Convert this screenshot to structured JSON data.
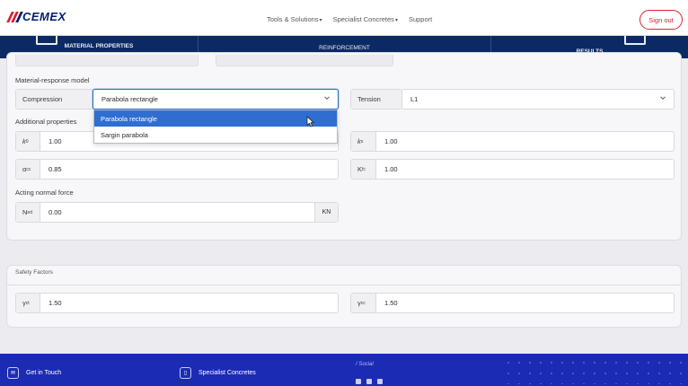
{
  "header": {
    "brand": "CEMEX",
    "nav": [
      "Tools & Solutions",
      "Specialist Concretes",
      "Support"
    ],
    "nav_caret": "▾",
    "signout_label": "Sign out"
  },
  "steps": {
    "items": [
      "MATERIAL PROPERTIES",
      "REINFORCEMENT",
      "RESULTS"
    ]
  },
  "material_model": {
    "section_label": "Material-response model",
    "compression": {
      "label": "Compression",
      "value": "Parabola rectangle"
    },
    "tension": {
      "label": "Tension",
      "value": "L1"
    },
    "dropdown_options": [
      "Parabola rectangle",
      "Sargin parabola"
    ],
    "dropdown_selected_index": 0
  },
  "additional": {
    "section_label": "Additional properties",
    "k0": {
      "label": "k0",
      "sub": "0",
      "value": "1.00"
    },
    "ks": {
      "label": "ks",
      "sub": "s",
      "value": "1.00"
    },
    "acc": {
      "label": "αcc",
      "sub": "cc",
      "value": "0.85"
    },
    "kfc": {
      "label": "Kfc",
      "sub": "fc",
      "value": "1.00"
    }
  },
  "normal_force": {
    "section_label": "Acting normal force",
    "ned": {
      "label": "Ned",
      "sub": "ed",
      "value": "0.00",
      "unit": "KN"
    }
  },
  "safety": {
    "section_label": "Safety Factors",
    "gct": {
      "label": "γct",
      "sub": "ct",
      "value": "1.50"
    },
    "gcc": {
      "label": "γcc",
      "sub": "cc",
      "value": "1.50"
    }
  },
  "footer": {
    "get_in_touch": "Get in Touch",
    "specialist": "Specialist Concretes",
    "social": "/ Social"
  },
  "colors": {
    "brand_red": "#d6242f",
    "brand_navy": "#0b2a64",
    "footer_blue": "#1c2bb3",
    "selection_blue": "#2f6ed0"
  }
}
